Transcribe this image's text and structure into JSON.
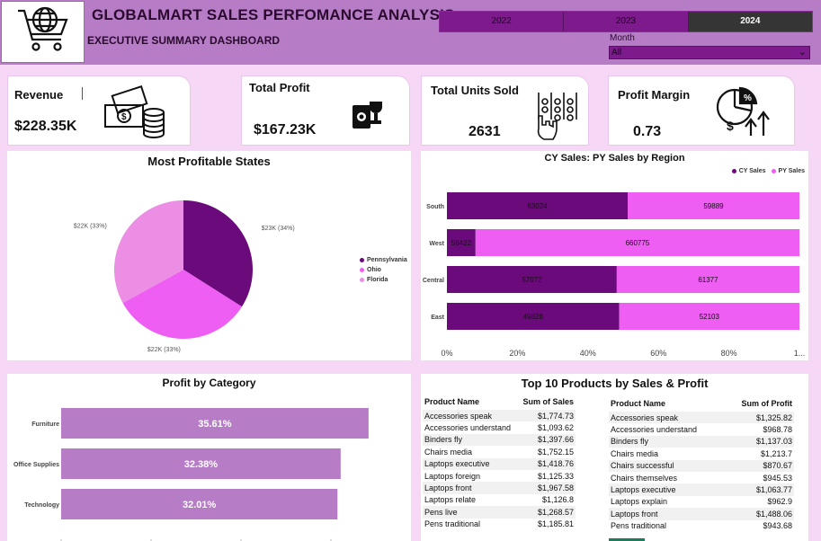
{
  "header": {
    "title": "GLOBALMART SALES PERFOMANCE ANALYSIS",
    "subtitle": "EXECUTIVE SUMMARY DASHBOARD",
    "logo_icon": "shopping-cart-globe-icon",
    "years": [
      "2022",
      "2023",
      "2024"
    ],
    "selected_year": "2024",
    "month_label": "Month",
    "month_value": "All"
  },
  "kpis": {
    "revenue": {
      "label": "Revenue",
      "value": "$228.35K",
      "icon": "cash-coins-icon"
    },
    "profit": {
      "label": "Total Profit",
      "value": "$167.23K",
      "icon": "trophy-icon"
    },
    "units": {
      "label": "Total Units Sold",
      "value": "2631",
      "icon": "counting-hand-icon"
    },
    "margin": {
      "label": "Profit  Margin",
      "value": "0.73",
      "icon": "pie-growth-icon"
    }
  },
  "colors": {
    "dark_purple": "#6b0a7a",
    "magenta": "#ee5ef2",
    "pink": "#ec8ee4",
    "bar_purple": "#b67cc6"
  },
  "chart_data": [
    {
      "type": "pie",
      "title": "Most Profitable States",
      "labels": [
        "Pennsylvania",
        "Ohio",
        "Florida"
      ],
      "values": [
        34,
        33,
        33
      ],
      "data_labels": [
        "$23K (34%)",
        "$22K (33%)",
        "$22K (33%)"
      ],
      "colors": [
        "#6b0a7a",
        "#ee5ef2",
        "#ec8ee4"
      ],
      "legend_position": "right"
    },
    {
      "type": "bar",
      "orientation": "horizontal",
      "stacked_percent": true,
      "title": "CY Sales: PY Sales by Region",
      "categories": [
        "South",
        "West",
        "Central",
        "East"
      ],
      "series": [
        {
          "name": "CY Sales",
          "values": [
            63024,
            58422,
            57072,
            49828
          ],
          "labels": [
            "63024",
            "58422",
            "57072",
            "49828"
          ],
          "color": "#6b0a7a"
        },
        {
          "name": "PY Sales",
          "values": [
            59889,
            660775,
            61377,
            52103
          ],
          "labels": [
            "59889",
            "660775",
            "61377",
            "52103"
          ],
          "color": "#ee5ef2"
        }
      ],
      "x_ticks": [
        "0%",
        "20%",
        "40%",
        "60%",
        "80%",
        "1..."
      ],
      "legend_position": "top-right"
    },
    {
      "type": "bar",
      "orientation": "horizontal",
      "title": "Profit by Category",
      "categories": [
        "Furniture",
        "Office Supplies",
        "Technology"
      ],
      "values": [
        35.61,
        32.38,
        32.01
      ],
      "labels": [
        "35.61%",
        "32.38%",
        "32.01%"
      ],
      "color": "#b67cc6",
      "xlim": [
        0,
        40
      ]
    }
  ],
  "top_products": {
    "title": "Top 10 Products by Sales & Profit",
    "sales_table": {
      "headers": [
        "Product Name",
        "Sum of Sales"
      ],
      "rows": [
        [
          "Accessories speak",
          "$1,774.73"
        ],
        [
          "Accessories understand",
          "$1,093.62"
        ],
        [
          "Binders fly",
          "$1,397.66"
        ],
        [
          "Chairs media",
          "$1,752.15"
        ],
        [
          "Laptops executive",
          "$1,418.76"
        ],
        [
          "Laptops foreign",
          "$1,125.33"
        ],
        [
          "Laptops front",
          "$1,967.58"
        ],
        [
          "Laptops relate",
          "$1,126.8"
        ],
        [
          "Pens live",
          "$1,268.57"
        ],
        [
          "Pens traditional",
          "$1,185.81"
        ]
      ]
    },
    "profit_table": {
      "headers": [
        "Product Name",
        "Sum of Profit"
      ],
      "rows": [
        [
          "Accessories speak",
          "$1,325.82"
        ],
        [
          "Accessories understand",
          "$968.78"
        ],
        [
          "Binders fly",
          "$1,137.03"
        ],
        [
          "Chairs media",
          "$1,213.7"
        ],
        [
          "Chairs successful",
          "$870.67"
        ],
        [
          "Chairs themselves",
          "$945.53"
        ],
        [
          "Laptops executive",
          "$1,063.77"
        ],
        [
          "Laptops explain",
          "$962.9"
        ],
        [
          "Laptops front",
          "$1,488.06"
        ],
        [
          "Pens traditional",
          "$943.68"
        ]
      ]
    }
  }
}
